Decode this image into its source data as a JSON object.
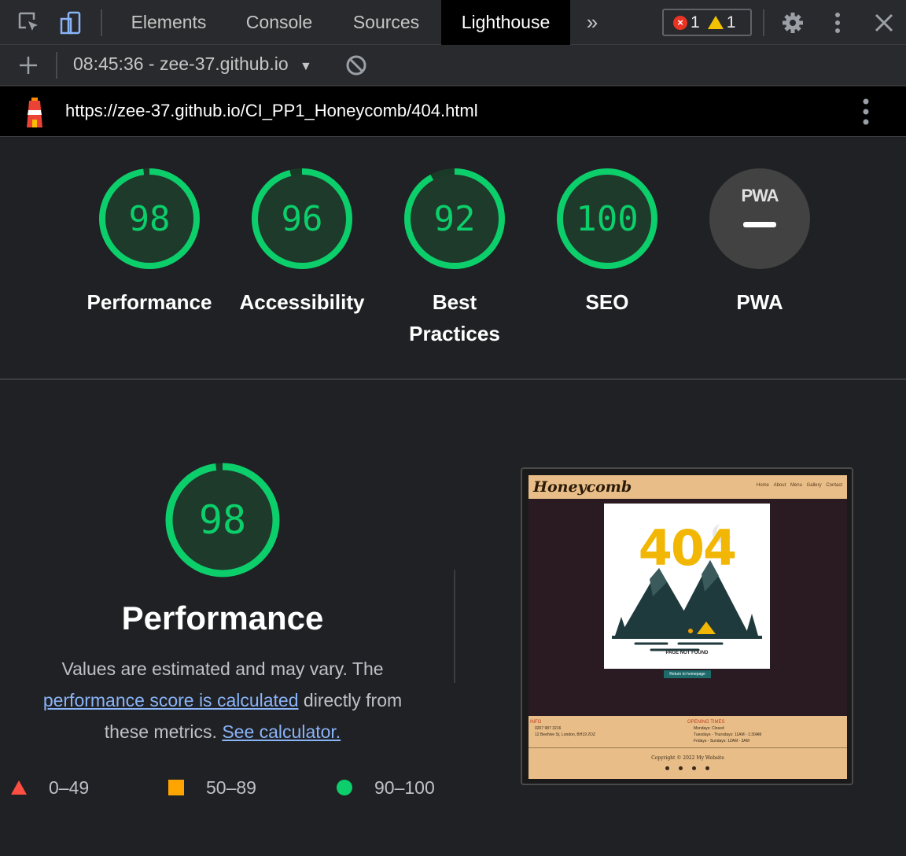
{
  "tabs": {
    "elements": "Elements",
    "console": "Console",
    "sources": "Sources",
    "lighthouse": "Lighthouse",
    "more": "»"
  },
  "issues": {
    "errors": "1",
    "warnings": "1"
  },
  "toolbar": {
    "report_label": "08:45:36 - zee-37.github.io"
  },
  "url": "https://zee-37.github.io/CI_PP1_Honeycomb/404.html",
  "scores": [
    {
      "label": "Performance",
      "value": "98",
      "fraction": 0.98
    },
    {
      "label": "Accessibility",
      "value": "96",
      "fraction": 0.96
    },
    {
      "label_line1": "Best",
      "label_line2": "Practices",
      "value": "92",
      "fraction": 0.92
    },
    {
      "label": "SEO",
      "value": "100",
      "fraction": 1.0
    },
    {
      "label": "PWA",
      "badge": "PWA"
    }
  ],
  "detail": {
    "score": "98",
    "fraction": 0.98,
    "title": "Performance",
    "desc_part1": "Values are estimated and may vary. The",
    "link1": "performance score is calculated",
    "desc_part2": " directly from these metrics. ",
    "link2": "See calculator."
  },
  "legend": {
    "fail": "0–49",
    "average": "50–89",
    "pass": "90–100"
  },
  "thumbnail": {
    "logo": "Honeycomb",
    "nav": [
      "Home",
      "About",
      "Menu",
      "Gallery",
      "Contact"
    ],
    "big_404": "404",
    "page_not_found": "PAGE NOT FOUND",
    "button": "Return to homepage",
    "info_heading": "INFO",
    "info_lines": [
      "0207 987 3216",
      "12 Beehive St, London, BH19 2OZ"
    ],
    "hours_heading": "OPENING TIMES",
    "hours_lines": [
      "Mondays: Closed",
      "Tuesdays - Thursdays: 11AM - 1:30AM",
      "Fridays - Sundays: 12AM - 3AM"
    ],
    "copyright": "Copyright © 2022 My Website"
  },
  "colors": {
    "pass": "#0cce6b",
    "average": "#ffa400",
    "fail": "#ff4e42",
    "link": "#8ab4f8"
  }
}
